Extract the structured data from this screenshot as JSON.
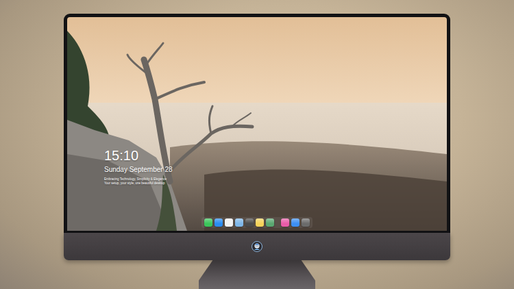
{
  "clock": {
    "time": "15:10",
    "date": "Sunday September 28",
    "note": [
      "Embracing Technology, Simplicity & Elegance",
      "Your setup, your style, one beautiful desktop"
    ]
  },
  "dock": {
    "groups": [
      {
        "apps": [
          {
            "color": "#3bc65a"
          },
          {
            "color": "#2a8cf0"
          },
          {
            "color": "#f2f2f2"
          },
          {
            "color": "#7fb7e8"
          },
          {
            "color": "#4a4a4a"
          },
          {
            "color": "#f6d35a"
          },
          {
            "color": "#5aa870"
          }
        ]
      },
      {
        "apps": [
          {
            "color": "#e85ca8"
          },
          {
            "color": "#3d8ff5"
          },
          {
            "color": "#6b6b6b"
          }
        ]
      }
    ]
  }
}
